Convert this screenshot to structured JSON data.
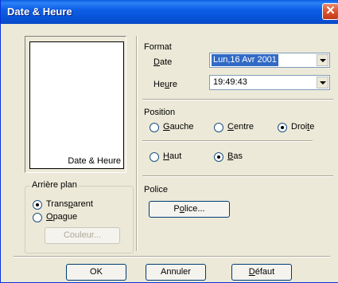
{
  "window": {
    "title": "Date & Heure",
    "close_glyph": "✕"
  },
  "preview": {
    "caption": "Date & Heure"
  },
  "format": {
    "heading": "Format",
    "date_label_first": "D",
    "date_label_rest": "ate",
    "date_value": "Lun,16 Avr 2001",
    "heure_label_first": "He",
    "heure_label_u": "u",
    "heure_label_rest": "re",
    "heure_value": "19:49:43"
  },
  "position": {
    "heading": "Position",
    "gauche_u": "G",
    "gauche_rest": "auche",
    "centre_u": "C",
    "centre_rest": "entre",
    "droite_first": "Droi",
    "droite_u": "t",
    "droite_rest": "e",
    "haut_u": "H",
    "haut_rest": "aut",
    "bas_u": "B",
    "bas_rest": "as",
    "horizontal_selected": "Droite",
    "vertical_selected": "Bas"
  },
  "arriere_plan": {
    "heading": "Arrière plan",
    "transparent_first": "Trans",
    "transparent_u": "p",
    "transparent_rest": "arent",
    "opaque_u": "O",
    "opaque_rest": "pague",
    "selected": "Transparent",
    "couleur_button": "Couleur..."
  },
  "police": {
    "heading": "Police",
    "button_first": "P",
    "button_u": "o",
    "button_rest": "lice..."
  },
  "footer": {
    "ok": "OK",
    "annuler": "Annuler",
    "defaut_u": "D",
    "defaut_rest": "éfaut"
  },
  "colors": {
    "title_bar": "#0a5be0",
    "selection": "#316ac5",
    "dialog_bg": "#ece9d8"
  }
}
